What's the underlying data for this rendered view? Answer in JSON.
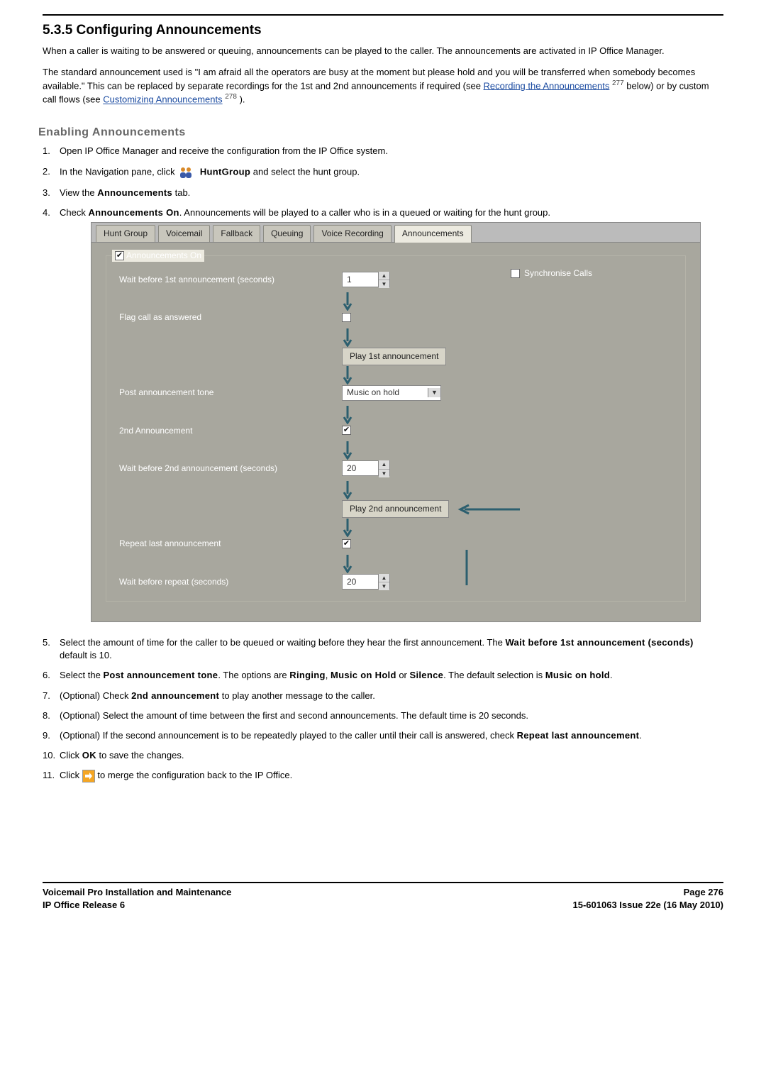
{
  "section": {
    "number": "5.3.5",
    "title": "Configuring Announcements",
    "intro1": "When a caller is waiting to be answered or queuing, announcements can be played to the caller. The announcements are activated in IP Office Manager.",
    "intro2a": "The standard announcement used is \"I am afraid all the operators are busy at the moment but please hold and you will be transferred when somebody becomes available.\" This can be replaced by separate recordings for the 1st and 2nd announcements if required (see ",
    "link1": "Recording the Announcements",
    "ref1": "277",
    "intro2b": " below) or by custom call flows (see ",
    "link2": "Customizing Announcements",
    "ref2": "278",
    "intro2c": ")."
  },
  "subsection_title": "Enabling Announcements",
  "steps": {
    "s1": "Open IP Office Manager and receive the configuration from the IP Office system.",
    "s2a": "In the Navigation pane, click ",
    "s2b": " HuntGroup",
    "s2c": " and select the hunt group.",
    "s3a": "View the ",
    "s3b": "Announcements",
    "s3c": " tab.",
    "s4a": "Check ",
    "s4b": "Announcements On",
    "s4c": ". Announcements will be played to a caller who is in a queued or waiting for the hunt group.",
    "s5a": "Select the amount of time for the caller to be queued or waiting before they hear the first announcement. The ",
    "s5b": "Wait before 1st announcement (seconds)",
    "s5c": " default is 10.",
    "s6a": "Select the ",
    "s6b": "Post announcement tone",
    "s6c": ". The options are ",
    "s6d": "Ringing",
    "s6e": ", ",
    "s6f": "Music on Hold",
    "s6g": " or ",
    "s6h": "Silence",
    "s6i": ". The default selection is ",
    "s6j": "Music on hold",
    "s6k": ".",
    "s7a": "(Optional) Check ",
    "s7b": "2nd announcement",
    "s7c": " to play another message to the caller.",
    "s8": "(Optional) Select the amount of time between the first and second announcements. The default time is 20 seconds.",
    "s9a": "(Optional) If the second announcement is to be repeatedly played to the caller until their call is answered, check ",
    "s9b": "Repeat last announcement",
    "s9c": ".",
    "s10a": "Click ",
    "s10b": "OK",
    "s10c": " to save the changes.",
    "s11a": "Click ",
    "s11b": " to merge the configuration back to the IP Office."
  },
  "tabs": {
    "t1": "Hunt Group",
    "t2": "Voicemail",
    "t3": "Fallback",
    "t4": "Queuing",
    "t5": "Voice Recording",
    "t6": "Announcements"
  },
  "form": {
    "announcements_on": "Announcements On",
    "wait1_label": "Wait before 1st announcement (seconds)",
    "wait1_value": "1",
    "sync_calls": "Synchronise Calls",
    "flag_answered": "Flag call as answered",
    "play1": "Play 1st announcement",
    "post_tone_label": "Post announcement tone",
    "post_tone_value": "Music on hold",
    "second_ann_label": "2nd Announcement",
    "wait2_label": "Wait before 2nd announcement (seconds)",
    "wait2_value": "20",
    "play2": "Play 2nd announcement",
    "repeat_label": "Repeat last announcement",
    "wait_repeat_label": "Wait before repeat (seconds)",
    "wait_repeat_value": "20"
  },
  "footer": {
    "left1": "Voicemail Pro Installation and Maintenance",
    "left2": "IP Office Release 6",
    "right1": "Page 276",
    "right2": "15-601063 Issue 22e (16 May 2010)"
  }
}
